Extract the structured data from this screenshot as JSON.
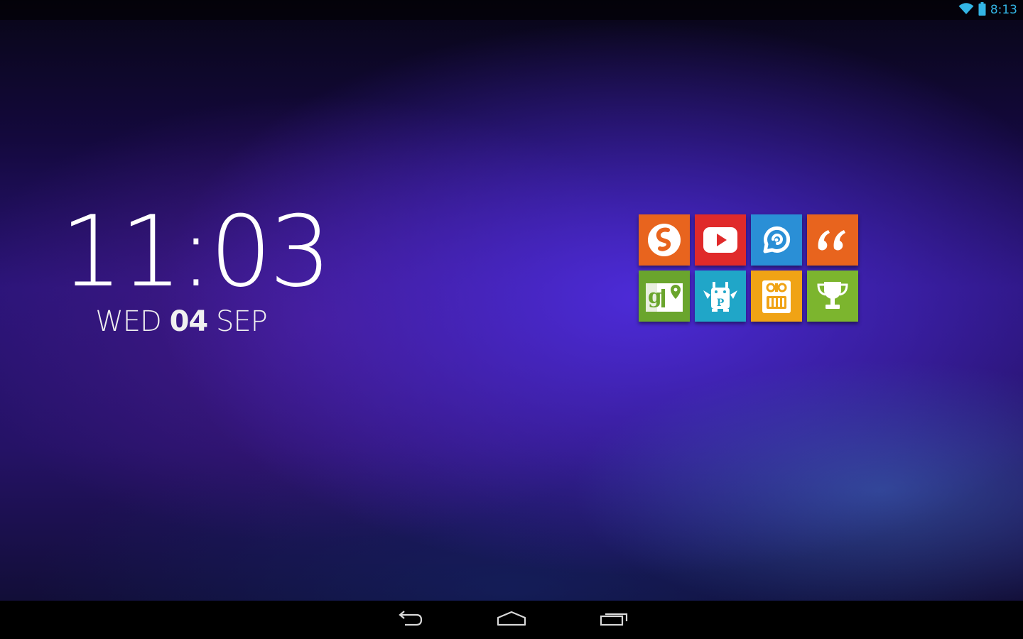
{
  "status_bar": {
    "time": "8:13",
    "wifi_icon": "wifi-icon",
    "battery_icon": "battery-icon",
    "accent": "#33b5e5"
  },
  "clock": {
    "time": "11:03",
    "weekday": "WED",
    "day": "04",
    "month": "SEP"
  },
  "apps": [
    {
      "icon": "soundhound-icon",
      "color": "#e8641e"
    },
    {
      "icon": "youtube-icon",
      "color": "#e02a2a"
    },
    {
      "icon": "shazam-like-icon",
      "color": "#2a8fd6"
    },
    {
      "icon": "quotes-icon",
      "color": "#e8641e"
    },
    {
      "icon": "gmaps-icon",
      "color": "#6aa52d"
    },
    {
      "icon": "monster-p-icon",
      "color": "#20a6c8"
    },
    {
      "icon": "temple-run-icon",
      "color": "#f0a315"
    },
    {
      "icon": "trophy-icon",
      "color": "#7cb52e"
    }
  ],
  "nav_bar": {
    "back_icon": "back-icon",
    "home_icon": "home-icon",
    "recents_icon": "recents-icon"
  }
}
